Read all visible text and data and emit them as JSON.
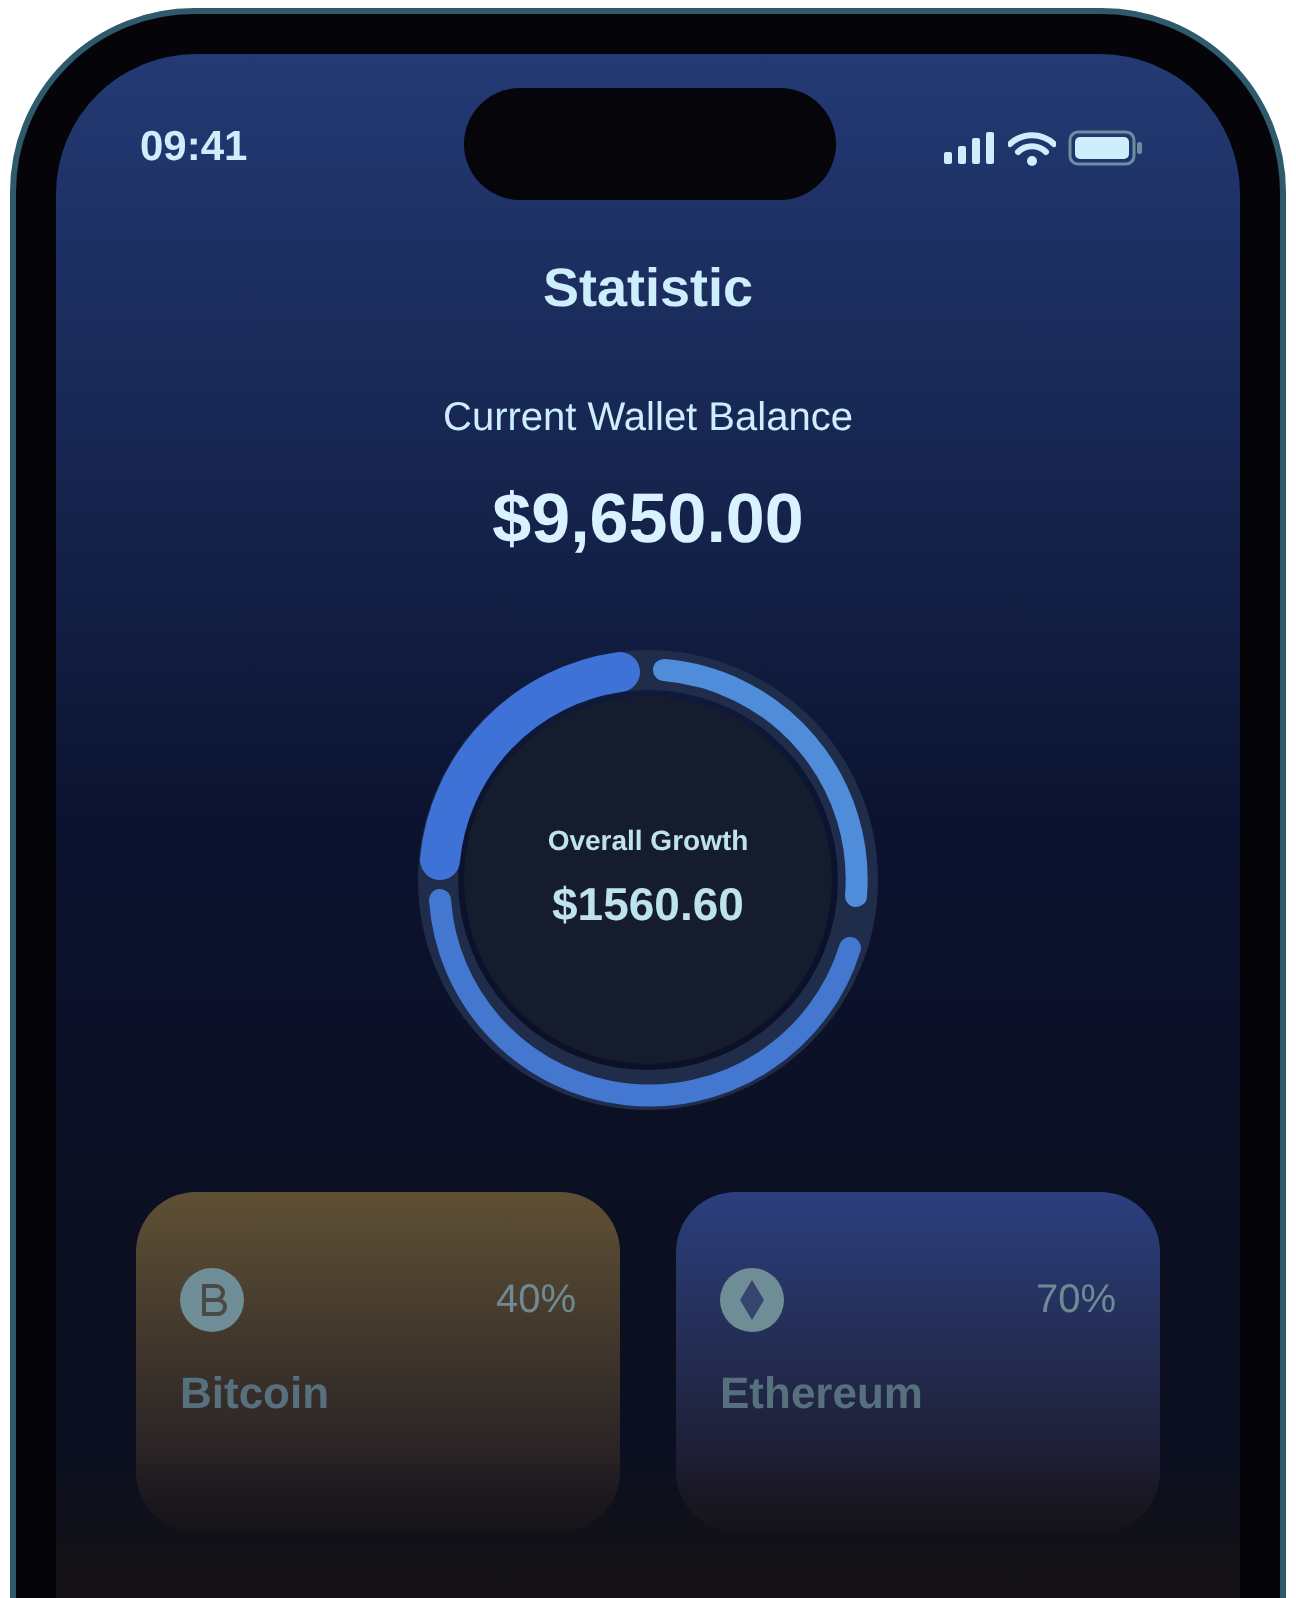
{
  "status_bar": {
    "time": "09:41"
  },
  "header": {
    "title": "Statistic"
  },
  "balance": {
    "label": "Current Wallet Balance",
    "amount": "$9,650.00"
  },
  "growth": {
    "label": "Overall Growth",
    "amount": "$1560.60"
  },
  "assets": [
    {
      "name": "Bitcoin",
      "percent": "40%",
      "color": "#5f5035"
    },
    {
      "name": "Ethereum",
      "percent": "70%",
      "color": "#2b3f7e"
    }
  ]
}
